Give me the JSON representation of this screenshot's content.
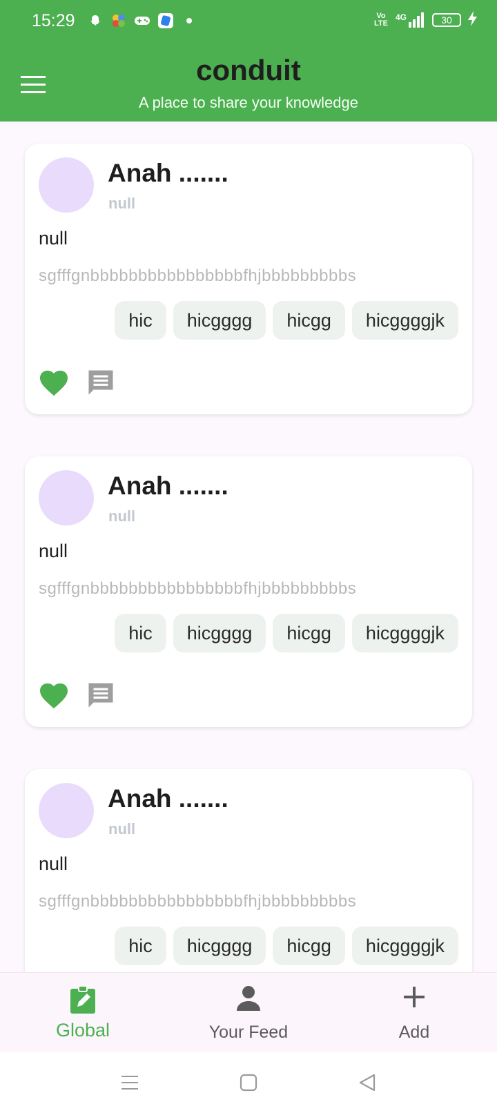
{
  "status_bar": {
    "time": "15:29",
    "network_label": "4G",
    "volte_label": "Vo LTE",
    "battery": "30",
    "icons": [
      "snapchat-icon",
      "pinwheel-icon",
      "gamepad-icon",
      "app-icon",
      "dot-icon",
      "signal-icon",
      "charging-icon"
    ]
  },
  "app_bar": {
    "title": "conduit",
    "subtitle": "A place to share your knowledge",
    "menu_icon": "hamburger-menu-icon"
  },
  "articles": [
    {
      "author": "Anah .......",
      "date": "null",
      "title": "null",
      "description": "sgfffgnbbbbbbbbbbbbbbbbfhjbbbbbbbbbs",
      "tags": [
        "hic",
        "hicgggg",
        "hicgg",
        "hicggggjk"
      ]
    },
    {
      "author": "Anah .......",
      "date": "null",
      "title": "null",
      "description": "sgfffgnbbbbbbbbbbbbbbbbfhjbbbbbbbbbs",
      "tags": [
        "hic",
        "hicgggg",
        "hicgg",
        "hicggggjk"
      ]
    },
    {
      "author": "Anah .......",
      "date": "null",
      "title": "null",
      "description": "sgfffgnbbbbbbbbbbbbbbbbfhjbbbbbbbbbs",
      "tags": [
        "hic",
        "hicgggg",
        "hicgg",
        "hicggggjk"
      ]
    }
  ],
  "bottom_nav": {
    "items": [
      {
        "label": "Global",
        "icon": "clipboard-edit-icon",
        "active": true
      },
      {
        "label": "Your Feed",
        "icon": "person-icon",
        "active": false
      },
      {
        "label": "Add",
        "icon": "plus-icon",
        "active": false
      }
    ]
  },
  "colors": {
    "primary": "#4caf50",
    "avatar": "#e9dbfc",
    "tag_bg": "#eef2ee",
    "muted_text": "#b8b8b8",
    "comment_icon": "#9e9e9e"
  }
}
